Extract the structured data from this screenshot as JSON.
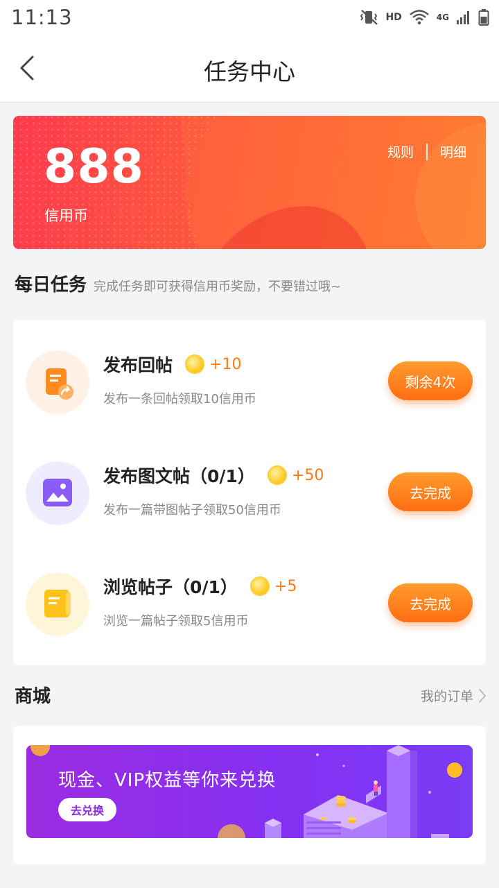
{
  "status_bar": {
    "time": "11:13",
    "hd": "HD",
    "network": "4G"
  },
  "header": {
    "title": "任务中心"
  },
  "balance": {
    "value": "888",
    "unit": "信用币",
    "rules_label": "规则",
    "detail_label": "明细"
  },
  "daily": {
    "title": "每日任务",
    "subtitle": "完成任务即可获得信用币奖励，不要错过哦~"
  },
  "tasks": [
    {
      "name": "发布回帖",
      "reward": "+10",
      "desc": "发布一条回帖领取10信用币",
      "button": "剩余4次"
    },
    {
      "name": "发布图文帖（0/1）",
      "reward": "+50",
      "desc": "发布一篇带图帖子领取50信用币",
      "button": "去完成"
    },
    {
      "name": "浏览帖子（0/1）",
      "reward": "+5",
      "desc": "浏览一篇帖子领取5信用币",
      "button": "去完成"
    }
  ],
  "mall": {
    "title": "商城",
    "orders_label": "我的订单",
    "banner_text": "现金、VIP权益等你来兑换",
    "banner_button": "去兑换"
  },
  "colors": {
    "accent": "#ff6d12",
    "banner_start": "#ff3b4e",
    "banner_end": "#ff7a2e",
    "mall_purple": "#8530f2"
  }
}
